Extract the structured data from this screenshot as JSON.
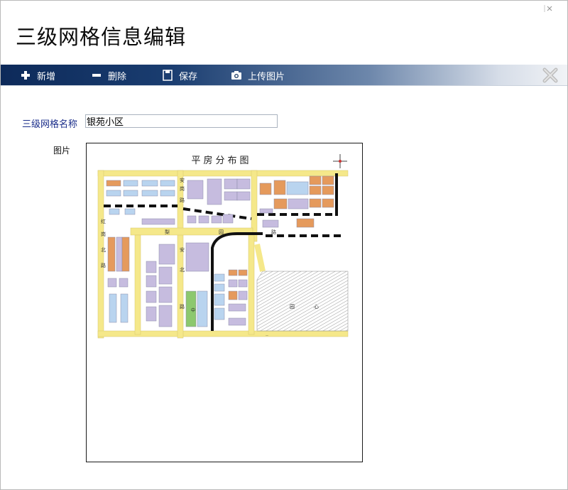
{
  "dialog": {
    "title": "三级网格信息编辑"
  },
  "toolbar": {
    "add_label": "新增",
    "delete_label": "删除",
    "save_label": "保存",
    "upload_label": "上传图片",
    "bg_start": "#0d2a5a",
    "bg_end": "#f1f3f6"
  },
  "form": {
    "name_label": "三级网格名称",
    "name_value": "银苑小区",
    "image_label": "图片"
  },
  "map": {
    "title": "平房分布图",
    "labels": {
      "hongwei_north": [
        "红",
        "岗",
        "北",
        "路"
      ],
      "an_road": [
        "安",
        "岗",
        "路"
      ],
      "li_road": [
        "梨",
        "园",
        "路"
      ],
      "an_north": [
        "安",
        "北",
        "路"
      ],
      "zhongxin": [
        "中",
        "心",
        "公",
        "园"
      ],
      "south": [
        "安",
        "南",
        "路"
      ],
      "yuan": "园",
      "xin": "心"
    }
  }
}
